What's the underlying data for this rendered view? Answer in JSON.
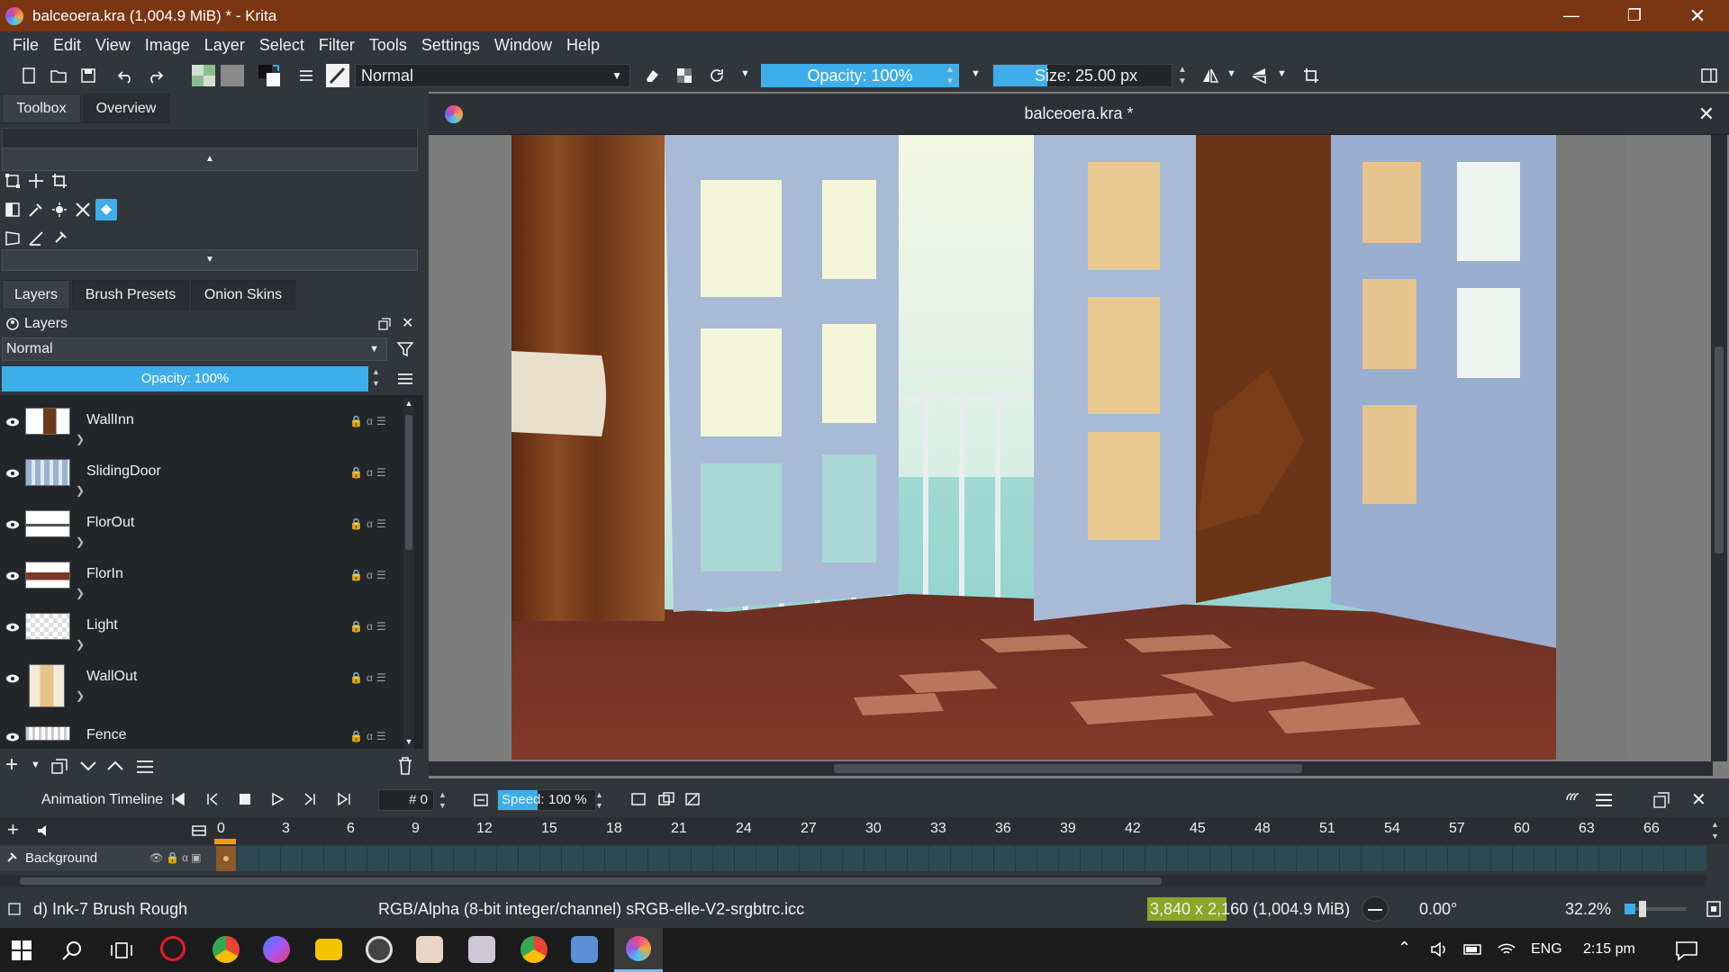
{
  "window": {
    "title": "balceoera.kra (1,004.9 MiB)  * - Krita"
  },
  "menu": [
    "File",
    "Edit",
    "View",
    "Image",
    "Layer",
    "Select",
    "Filter",
    "Tools",
    "Settings",
    "Window",
    "Help"
  ],
  "toolbar": {
    "blend_mode": "Normal",
    "opacity_label": "Opacity: 100%",
    "size_label": "Size: 25.00 px"
  },
  "docker_tabs": {
    "toolbox": "Toolbox",
    "overview": "Overview"
  },
  "layers_tabs": {
    "layers": "Layers",
    "brush_presets": "Brush Presets",
    "onion_skins": "Onion Skins"
  },
  "layers_panel": {
    "title": "Layers",
    "blend_mode": "Normal",
    "opacity_label": "Opacity:  100%",
    "layers": [
      {
        "name": "WallInn"
      },
      {
        "name": "SlidingDoor"
      },
      {
        "name": "FlorOut"
      },
      {
        "name": "FlorIn"
      },
      {
        "name": "Light"
      },
      {
        "name": "WallOut"
      },
      {
        "name": "Fence"
      }
    ]
  },
  "document": {
    "tab_title": "balceoera.kra *"
  },
  "timeline": {
    "title": "Animation Timeline",
    "current_frame": "0",
    "frame_prefix": "#",
    "speed_label": "Speed:",
    "speed_value": "100 %",
    "frame_numbers": [
      "0",
      "3",
      "6",
      "9",
      "12",
      "15",
      "18",
      "21",
      "24",
      "27",
      "30",
      "33",
      "36",
      "39",
      "42",
      "45",
      "48",
      "51",
      "54",
      "57",
      "60",
      "63",
      "66"
    ],
    "layer_name": "Background"
  },
  "status": {
    "brush": "d) Ink-7 Brush Rough",
    "color_space": "RGB/Alpha (8-bit integer/channel)  sRGB-elle-V2-srgbtrc.icc",
    "image_size": "3,840 x 2,160 (1,004.9 MiB)",
    "rotation": "0.00°",
    "zoom": "32.2%"
  },
  "taskbar": {
    "language": "ENG",
    "time": "2:15 pm"
  },
  "colors": {
    "accent": "#3daee9",
    "titlebar": "#7a3512",
    "panel": "#31363b",
    "status_highlight": "#8ea52a"
  }
}
